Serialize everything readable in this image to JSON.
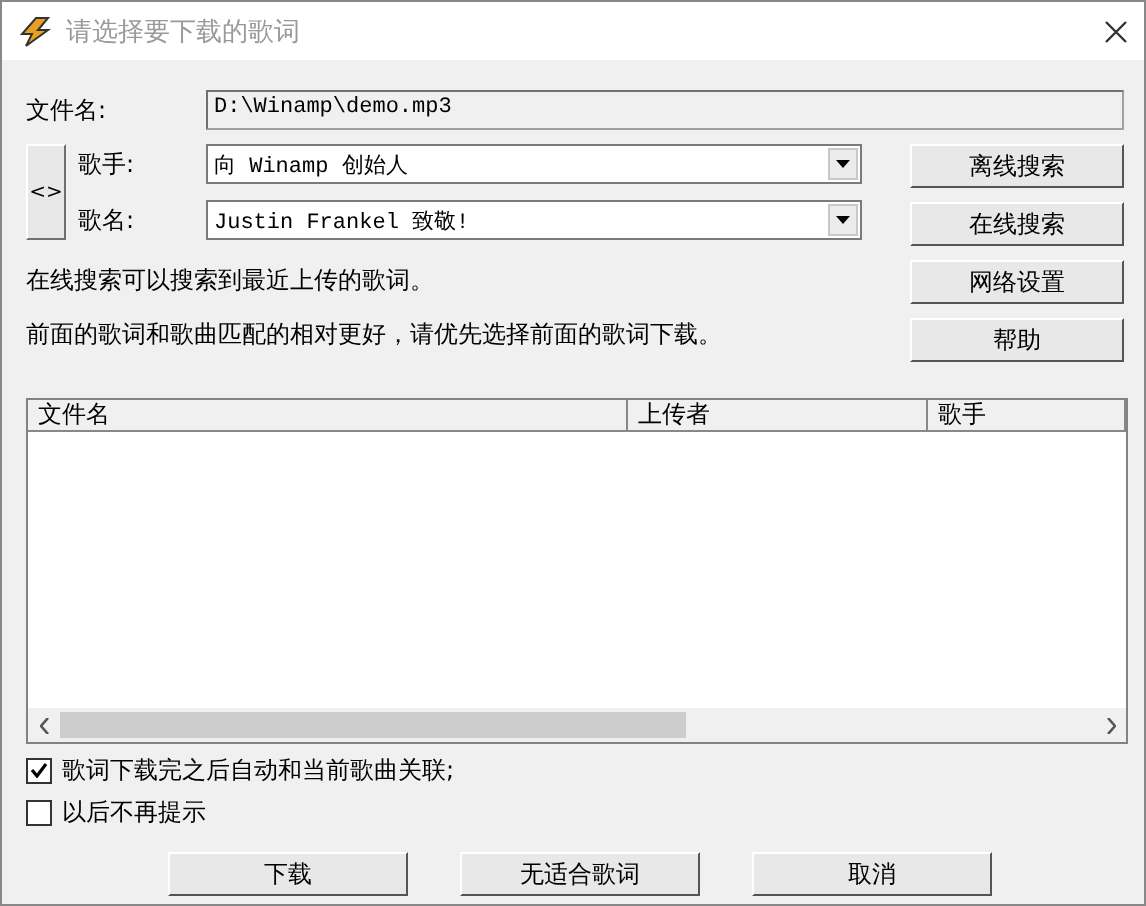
{
  "window": {
    "title": "请选择要下载的歌词"
  },
  "file": {
    "label": "文件名:",
    "value": "D:\\Winamp\\demo.mp3"
  },
  "swap_button": {
    "label": "<>"
  },
  "artist": {
    "label": "歌手:",
    "value": "向 Winamp 创始人"
  },
  "song": {
    "label": "歌名:",
    "value": "Justin Frankel 致敬!"
  },
  "info": [
    "在线搜索可以搜索到最近上传的歌词。",
    "前面的歌词和歌曲匹配的相对更好，请优先选择前面的歌词下载。"
  ],
  "side_buttons": [
    "离线搜索",
    "在线搜索",
    "网络设置",
    "帮助"
  ],
  "table": {
    "columns": [
      "文件名",
      "上传者",
      "歌手"
    ]
  },
  "options": [
    {
      "label": "歌词下载完之后自动和当前歌曲关联;",
      "checked": true
    },
    {
      "label": "以后不再提示",
      "checked": false
    }
  ],
  "buttons": [
    "下载",
    "无适合歌词",
    "取消"
  ]
}
